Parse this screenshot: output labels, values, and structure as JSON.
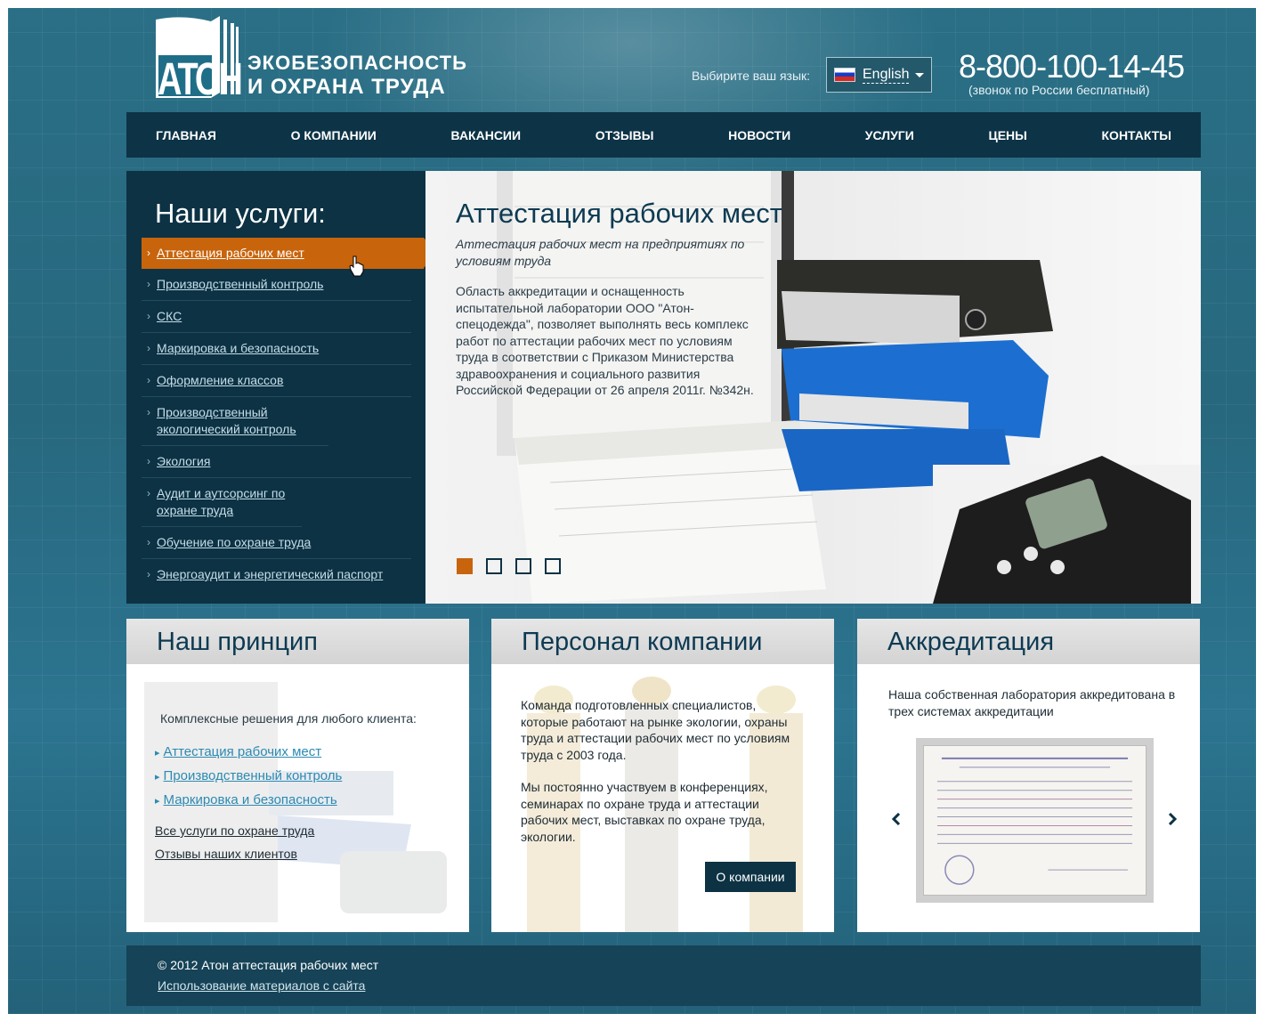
{
  "header": {
    "logo_mark": "АТОН",
    "logo_line1": "ЭКОБЕЗОПАСНОСТЬ",
    "logo_line2": "И ОХРАНА ТРУДА",
    "lang_label": "Выбирите ваш язык:",
    "lang_selected": "English",
    "phone": "8-800-100-14-45",
    "phone_note": "(звонок по России бесплатный)"
  },
  "nav": [
    "ГЛАВНАЯ",
    "О КОМПАНИИ",
    "ВАКАНСИИ",
    "ОТЗЫВЫ",
    "НОВОСТИ",
    "УСЛУГИ",
    "ЦЕНЫ",
    "КОНТАКТЫ"
  ],
  "services": {
    "title": "Наши услуги:",
    "items": [
      "Аттестация рабочих мест",
      "Производственный контроль",
      "СКС",
      "Маркировка и безопасность",
      "Оформление классов",
      "Производственный экологический контроль",
      "Экология",
      "Аудит и аутсорсинг по охране труда",
      "Обучение по охране труда",
      "Энергоаудит и энергетический паспорт"
    ],
    "active_index": 0
  },
  "hero": {
    "title": "Аттестация рабочих мест",
    "subtitle": "Аттестация рабочих мест на предприятиях по условиям труда",
    "text": "Область аккредитации и оснащенность испытательной лаборатории ООО \"Атон-спецодежда\", позволяет выполнять весь комплекс работ по аттестации рабочих мест по условиям труда в соответствии с Приказом Министерства здравоохранения и социального развития Российской Федерации от 26 апреля 2011г. №342н.",
    "slide_count": 4,
    "current_slide": 1
  },
  "card1": {
    "title": "Наш принцип",
    "lead": "Комплексные решения для любого клиента:",
    "links": [
      "Аттестация рабочих мест",
      "Производственный контроль",
      "Маркировка и безопасность"
    ],
    "more": [
      "Все услуги по охране труда",
      "Отзывы наших клиентов"
    ]
  },
  "card2": {
    "title": "Персонал компании",
    "p1": "Команда подготовленных специалистов, которые работают на рынке экологии, охраны труда и аттестации рабочих мест по условиям труда с 2003 года.",
    "p2": "Мы постоянно участвуем в конференциях, семинарах по охране труда и аттестации рабочих мест, выставках по охране труда, экологии.",
    "button": "О компании"
  },
  "card3": {
    "title": "Аккредитация",
    "text": "Наша собственная лаборатория аккредитована в трех системах аккредитации"
  },
  "footer": {
    "copyright": "© 2012 Атон аттестация рабочих мест",
    "usage_link": "Использование материалов с сайта"
  },
  "colors": {
    "accent": "#c8640c",
    "dark_panel": "#0c3244",
    "link": "#2c8ab2",
    "background": "#27687e"
  },
  "icons": [
    "logo-book-icon",
    "russia-flag-icon",
    "chevron-down-icon",
    "hand-cursor-icon",
    "arrow-left-icon",
    "arrow-right-icon"
  ]
}
